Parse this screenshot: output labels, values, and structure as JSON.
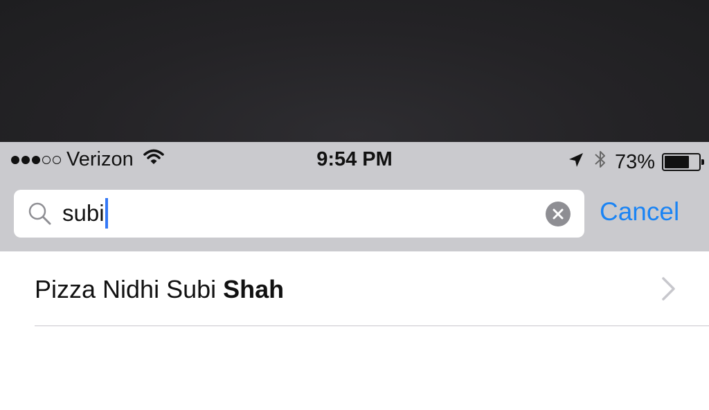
{
  "status_bar": {
    "carrier": "Verizon",
    "signal_bars_filled": 3,
    "signal_bars_total": 5,
    "time": "9:54 PM",
    "battery_percent_label": "73%",
    "battery_level": 0.73
  },
  "search": {
    "query": "subi",
    "cancel_label": "Cancel"
  },
  "results": [
    {
      "label_regular": "Pizza Nidhi Subi ",
      "label_bold": "Shah"
    }
  ],
  "colors": {
    "accent": "#1b84f4",
    "caret": "#3478f6",
    "chrome_background": "#cacace"
  },
  "icons": [
    "wifi-icon",
    "location-arrow-icon",
    "bluetooth-icon",
    "battery-icon",
    "search-icon",
    "clear-icon",
    "chevron-right-icon"
  ]
}
